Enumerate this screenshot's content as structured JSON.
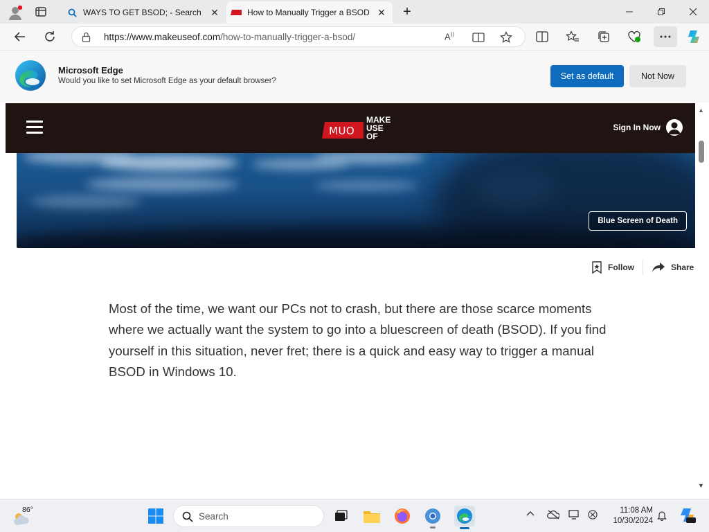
{
  "browser": {
    "tabs": [
      {
        "label": "WAYS TO GET BSOD; - Search",
        "active": false
      },
      {
        "label": "How to Manually Trigger a BSOD",
        "active": true
      }
    ],
    "url_host": "https://www.makeuseof.com",
    "url_path": "/how-to-manually-trigger-a-bsod/"
  },
  "default_prompt": {
    "title": "Microsoft Edge",
    "message": "Would you like to set Microsoft Edge as your default browser?",
    "primary_button": "Set as default",
    "secondary_button": "Not Now"
  },
  "site": {
    "logo_mark": "MUO",
    "logo_words": [
      "MAKE",
      "USE",
      "OF"
    ],
    "sign_in": "Sign In Now",
    "hero_tag": "Blue Screen of Death",
    "follow": "Follow",
    "share": "Share",
    "article_paragraph": "Most of the time, we want our PCs not to crash, but there are those scarce moments where we actually want the system to go into a bluescreen of death (BSOD). If you find yourself in this situation, never fret; there is a quick and easy way to trigger a manual BSOD in Windows 10."
  },
  "taskbar": {
    "weather_temp": "86°",
    "search_placeholder": "Search",
    "time": "11:08 AM",
    "date": "10/30/2024"
  },
  "colors": {
    "edge_accent": "#0f6cbd",
    "muo_red": "#d0161e",
    "site_header_bg": "#1f1412"
  }
}
